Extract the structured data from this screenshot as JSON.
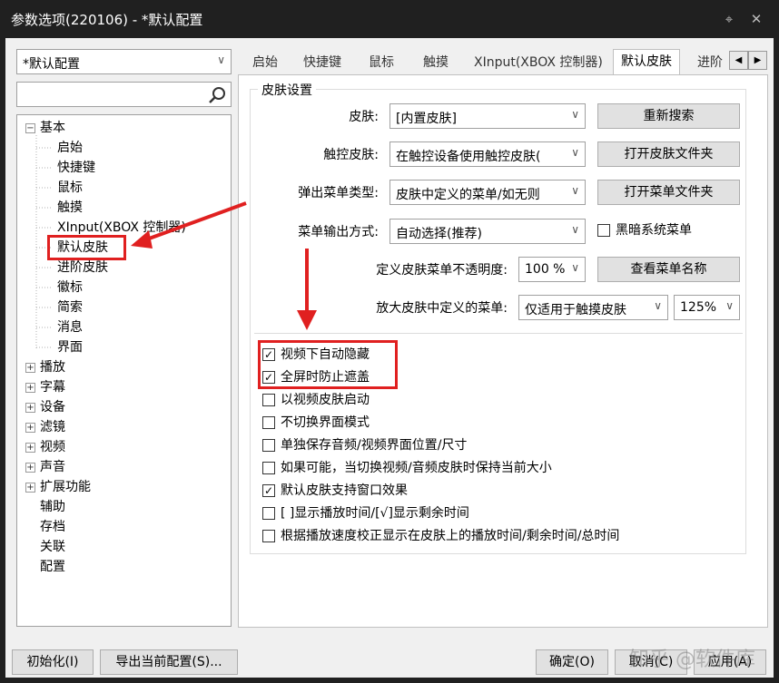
{
  "window": {
    "title": "参数选项(220106) - *默认配置",
    "pin_icon": "pin-icon",
    "close_icon": "close-icon"
  },
  "profile_combo": {
    "value": "*默认配置"
  },
  "search": {
    "value": "",
    "icon": "magnifier-icon"
  },
  "tree": {
    "root": "基本",
    "children": [
      "启始",
      "快捷键",
      "鼠标",
      "触摸",
      "XInput(XBOX 控制器)",
      "默认皮肤",
      "进阶皮肤",
      "徽标",
      "简索",
      "消息",
      "界面"
    ],
    "collapsed": [
      "播放",
      "字幕",
      "设备",
      "滤镜",
      "视频",
      "声音",
      "扩展功能"
    ],
    "leaves": [
      "辅助",
      "存档",
      "关联",
      "配置"
    ]
  },
  "tabs": [
    "启始",
    "快捷键",
    "鼠标",
    "触摸",
    "XInput(XBOX 控制器)",
    "默认皮肤",
    "进阶"
  ],
  "active_tab": "默认皮肤",
  "group": {
    "title": "皮肤设置",
    "skin_label": "皮肤:",
    "skin_value": "[内置皮肤]",
    "touch_label": "触控皮肤:",
    "touch_value": "在触控设备使用触控皮肤(",
    "popup_label": "弹出菜单类型:",
    "popup_value": "皮肤中定义的菜单/如无则",
    "menu_output_label": "菜单输出方式:",
    "menu_output_value": "自动选择(推荐)",
    "opacity_label": "定义皮肤菜单不透明度:",
    "opacity_value": "100 %",
    "enlarge_label": "放大皮肤中定义的菜单:",
    "enlarge_value": "仅适用于触摸皮肤",
    "enlarge_scale": "125%",
    "btn_research": "重新搜索",
    "btn_open_skin": "打开皮肤文件夹",
    "btn_open_menu": "打开菜单文件夹",
    "dark_menu_label": "黑暗系统菜单",
    "btn_view_menu": "查看菜单名称"
  },
  "checkboxes": [
    {
      "label": "视频下自动隐藏",
      "checked": true
    },
    {
      "label": "全屏时防止遮盖",
      "checked": true
    },
    {
      "label": "以视频皮肤启动",
      "checked": false
    },
    {
      "label": "不切换界面模式",
      "checked": false
    },
    {
      "label": "单独保存音频/视频界面位置/尺寸",
      "checked": false
    },
    {
      "label": "如果可能，当切换视频/音频皮肤时保持当前大小",
      "checked": false
    },
    {
      "label": "默认皮肤支持窗口效果",
      "checked": true
    },
    {
      "label": "[ ]显示播放时间/[√]显示剩余时间",
      "checked": false
    },
    {
      "label": "根据播放速度校正显示在皮肤上的播放时间/剩余时间/总时间",
      "checked": false
    }
  ],
  "footer": {
    "init": "初始化(I)",
    "export": "导出当前配置(S)...",
    "ok": "确定(O)",
    "cancel": "取消(C)",
    "apply": "应用(A)"
  },
  "watermark": "知乎 @软件库",
  "colors": {
    "highlight": "#e02020",
    "titlebar": "#202020",
    "dialog": "#f0f0f0"
  }
}
